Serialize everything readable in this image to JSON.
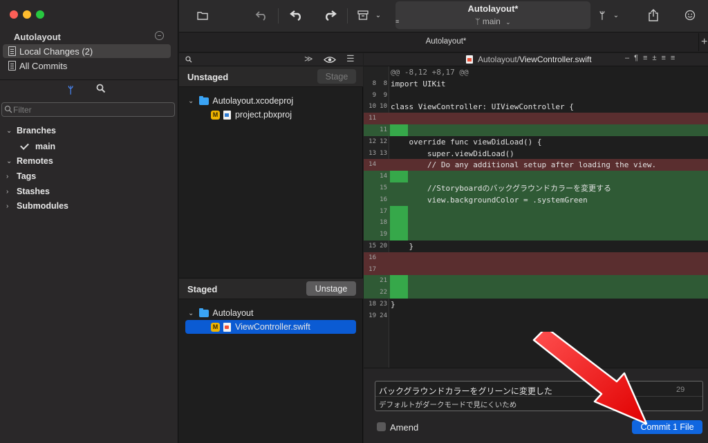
{
  "sidebar": {
    "repo_title": "Autolayout",
    "items": [
      {
        "label": "Local Changes (2)"
      },
      {
        "label": "All Commits"
      }
    ],
    "filter_placeholder": "Filter",
    "tree": {
      "branches": "Branches",
      "current_branch": "main",
      "remotes": "Remotes",
      "tags": "Tags",
      "stashes": "Stashes",
      "submodules": "Submodules"
    }
  },
  "toolbar": {
    "title": "Autolayout*",
    "branch": "main",
    "tab": "Autolayout*",
    "plus": "+"
  },
  "unstaged": {
    "title": "Unstaged",
    "button": "Stage",
    "folder": "Autolayout.xcodeproj",
    "file_badge": "M",
    "file": "project.pbxproj"
  },
  "staged": {
    "title": "Staged",
    "button": "Unstage",
    "folder": "Autolayout",
    "file_badge": "M",
    "file": "ViewController.swift"
  },
  "diff": {
    "path_prefix": "Autolayout/",
    "path_file": "ViewController.swift",
    "lines": [
      {
        "old": "",
        "new": "",
        "text": "@@ -8,12 +8,17 @@",
        "kind": "hunk"
      },
      {
        "old": "8",
        "new": "8",
        "text": "import UIKit",
        "kind": "ctx"
      },
      {
        "old": "9",
        "new": "9",
        "text": "",
        "kind": "ctx"
      },
      {
        "old": "10",
        "new": "10",
        "text": "class ViewController: UIViewController {",
        "kind": "ctx"
      },
      {
        "old": "11",
        "new": "",
        "text": "",
        "kind": "del"
      },
      {
        "old": "",
        "new": "11",
        "text": "",
        "kind": "add"
      },
      {
        "old": "12",
        "new": "12",
        "text": "    override func viewDidLoad() {",
        "kind": "ctx"
      },
      {
        "old": "13",
        "new": "13",
        "text": "        super.viewDidLoad()",
        "kind": "ctx"
      },
      {
        "old": "14",
        "new": "",
        "text": "        // Do any additional setup after loading the view.",
        "kind": "del"
      },
      {
        "old": "",
        "new": "14",
        "text": "",
        "kind": "add"
      },
      {
        "old": "",
        "new": "15",
        "text": "        //Storyboardのバックグラウンドカラーを変更する",
        "kind": "add"
      },
      {
        "old": "",
        "new": "16",
        "text": "        view.backgroundColor = .systemGreen",
        "kind": "add"
      },
      {
        "old": "",
        "new": "17",
        "text": "",
        "kind": "add"
      },
      {
        "old": "",
        "new": "18",
        "text": "",
        "kind": "add"
      },
      {
        "old": "",
        "new": "19",
        "text": "",
        "kind": "add"
      },
      {
        "old": "15",
        "new": "20",
        "text": "    }",
        "kind": "ctx"
      },
      {
        "old": "16",
        "new": "",
        "text": "",
        "kind": "del"
      },
      {
        "old": "17",
        "new": "",
        "text": "",
        "kind": "del"
      },
      {
        "old": "",
        "new": "21",
        "text": "",
        "kind": "add"
      },
      {
        "old": "",
        "new": "22",
        "text": "",
        "kind": "add"
      },
      {
        "old": "18",
        "new": "23",
        "text": "}",
        "kind": "ctx"
      },
      {
        "old": "19",
        "new": "24",
        "text": "",
        "kind": "ctx"
      }
    ]
  },
  "commit": {
    "subject": "バックグラウンドカラーをグリーンに変更した",
    "body": "デフォルトがダークモードで見にくいため",
    "char_count": "29",
    "amend_label": "Amend",
    "button": "Commit 1 File"
  },
  "colors": {
    "accent": "#1066e0",
    "added_line": "#2f5a35",
    "removed_line": "#5a2e2f",
    "annotation_arrow": "#ff1a1a"
  }
}
